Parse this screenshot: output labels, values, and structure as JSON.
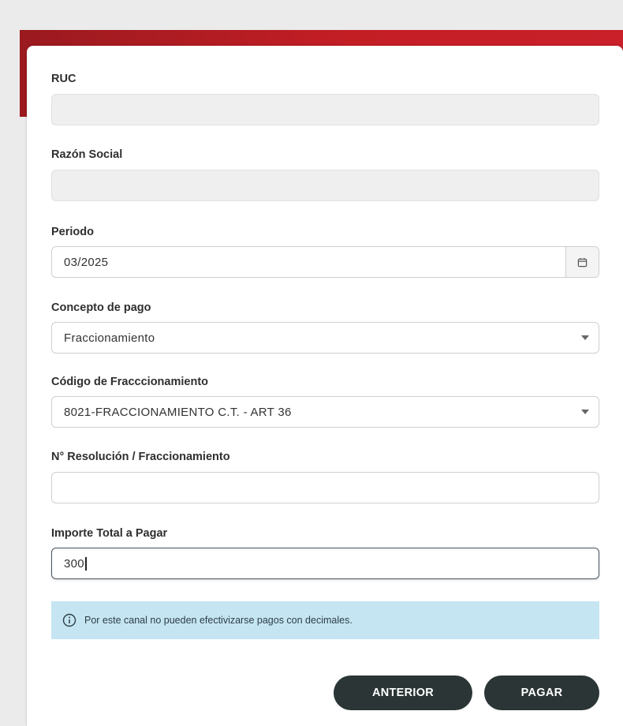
{
  "form": {
    "ruc": {
      "label": "RUC",
      "value": ""
    },
    "razon_social": {
      "label": "Razón Social",
      "value": ""
    },
    "periodo": {
      "label": "Periodo",
      "value": "03/2025",
      "addon_icon": "calendar-icon"
    },
    "concepto": {
      "label": "Concepto de pago",
      "value": "Fraccionamiento"
    },
    "codigo": {
      "label": "Código de Fracccionamiento",
      "value": "8021-FRACCIONAMIENTO C.T. - ART 36"
    },
    "resolucion": {
      "label": "N° Resolución / Fraccionamiento",
      "value": ""
    },
    "importe": {
      "label": "Importe Total a Pagar",
      "value": "300"
    }
  },
  "alert": {
    "icon": "info-icon",
    "text": "Por este canal no pueden efectivizarse pagos con decimales."
  },
  "buttons": {
    "anterior": "ANTERIOR",
    "pagar": "PAGAR"
  },
  "colors": {
    "header_red": "#c41e25",
    "button_dark": "#2b3535",
    "alert_bg": "#c5e5f3"
  }
}
